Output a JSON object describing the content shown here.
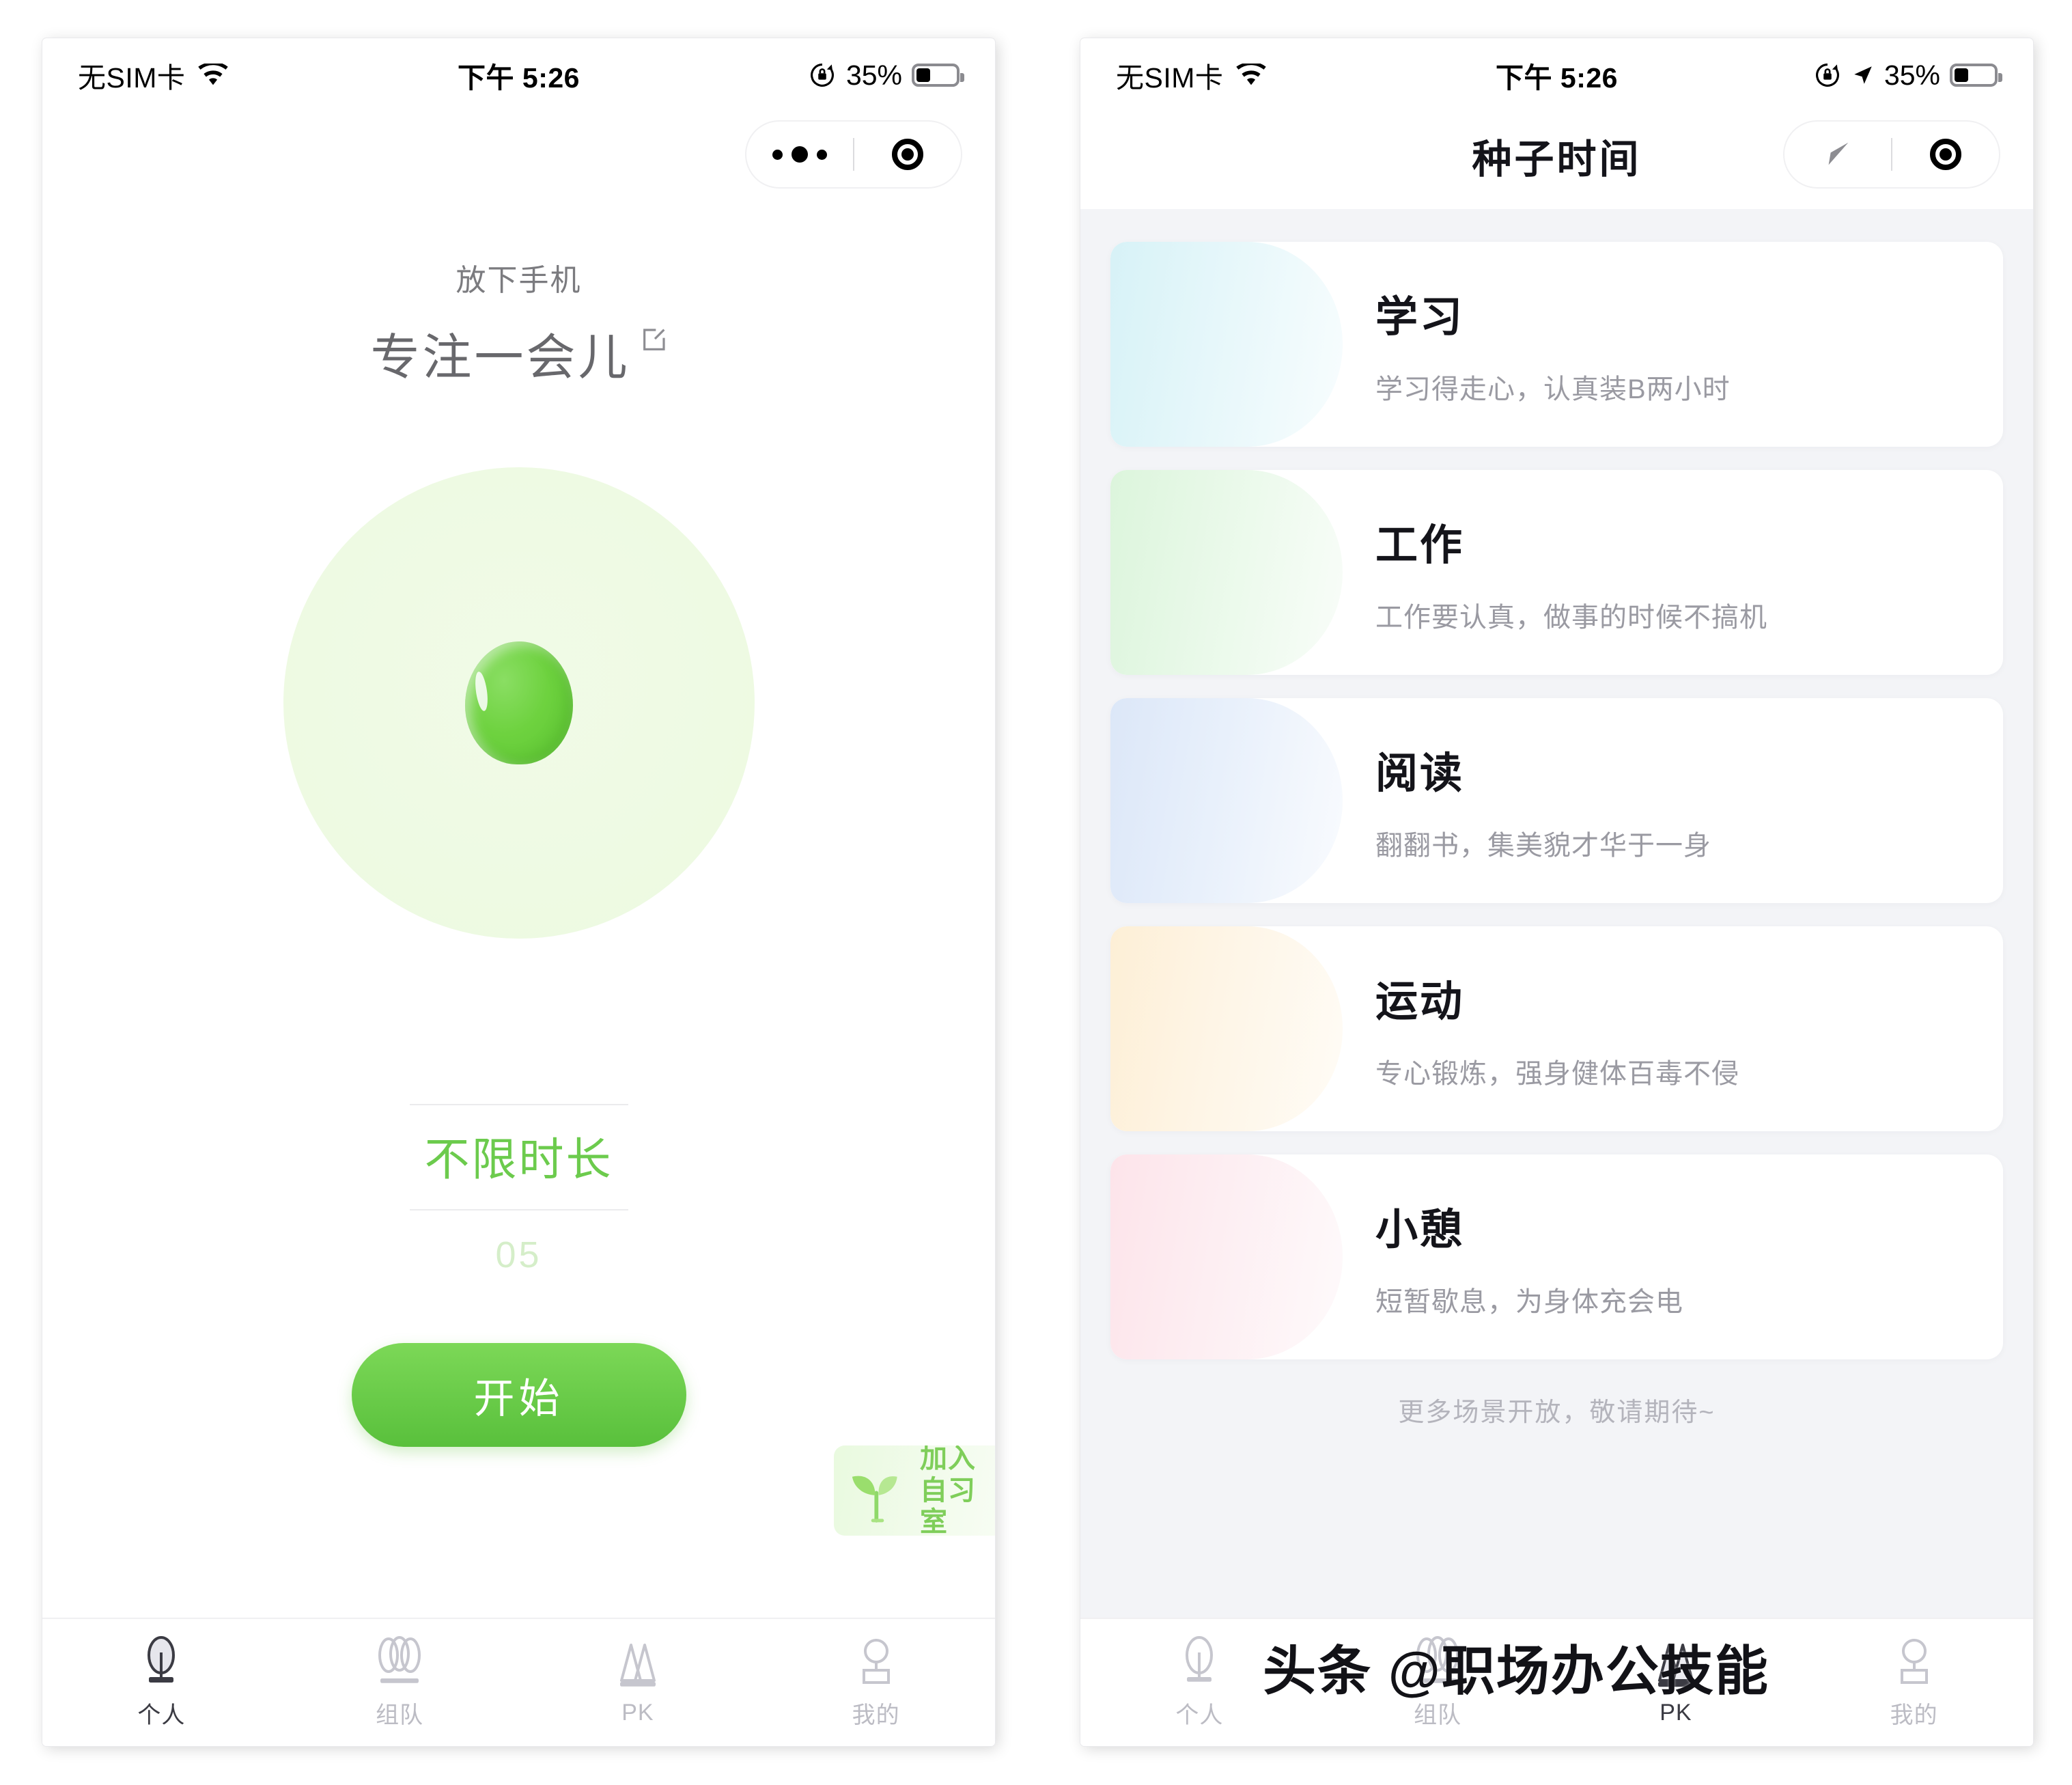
{
  "status_bar": {
    "carrier": "无SIM卡",
    "time": "下午 5:26",
    "battery_percent": "35%",
    "icons": [
      "wifi-icon",
      "rotation-lock-icon",
      "location-arrow-icon",
      "battery-icon"
    ]
  },
  "left_screen": {
    "capsule": {
      "menu_icon": "more-dots-icon",
      "close_icon": "target-circle-icon"
    },
    "header": {
      "subtitle": "放下手机",
      "title": "专注一会儿",
      "edit_icon": "edit-square-icon"
    },
    "seed": {
      "icon": "green-bean-seed-icon"
    },
    "duration": {
      "selected": "不限时长",
      "next": "05"
    },
    "start_button": "开始",
    "join_badge": {
      "line1": "加入",
      "line2": "自习室",
      "icon": "sprout-icon"
    },
    "tabs": [
      {
        "label": "个人",
        "icon": "single-tree-icon",
        "active": true
      },
      {
        "label": "组队",
        "icon": "three-trees-icon",
        "active": false
      },
      {
        "label": "PK",
        "icon": "two-pines-icon",
        "active": false
      },
      {
        "label": "我的",
        "icon": "person-icon",
        "active": false
      }
    ]
  },
  "right_screen": {
    "capsule": {
      "back_icon": "navigation-arrow-icon",
      "close_icon": "target-circle-icon"
    },
    "title": "种子时间",
    "scenes": [
      {
        "name": "学习",
        "desc": "学习得走心，认真装B两小时",
        "tint_from": "#d7f2f7",
        "tint_to": "#f4fcfd"
      },
      {
        "name": "工作",
        "desc": "工作要认真，做事的时候不搞机",
        "tint_from": "#dcf5dc",
        "tint_to": "#f6fcf6"
      },
      {
        "name": "阅读",
        "desc": "翻翻书，集美貌才华于一身",
        "tint_from": "#dce7f8",
        "tint_to": "#f6f9fd"
      },
      {
        "name": "运动",
        "desc": "专心锻炼，强身健体百毒不侵",
        "tint_from": "#fdefd6",
        "tint_to": "#fffaf1"
      },
      {
        "name": "小憩",
        "desc": "短暂歇息，为身体充会电",
        "tint_from": "#fde4ea",
        "tint_to": "#fef7f9"
      }
    ],
    "more_note": "更多场景开放，敬请期待~",
    "tabs": [
      {
        "label": "个人",
        "icon": "single-tree-icon",
        "active": false
      },
      {
        "label": "组队",
        "icon": "three-trees-icon",
        "active": false
      },
      {
        "label": "PK",
        "icon": "two-pines-icon",
        "active": true
      },
      {
        "label": "我的",
        "icon": "person-icon",
        "active": false
      }
    ]
  },
  "watermark": "头条 @职场办公技能",
  "colors": {
    "brand_green": "#6ccb4d",
    "button_green_top": "#7cd857",
    "button_green_bottom": "#59c03c",
    "panel_bg": "#f3f4f7",
    "text_dark": "#14141a",
    "text_muted": "#9a9aa2"
  }
}
